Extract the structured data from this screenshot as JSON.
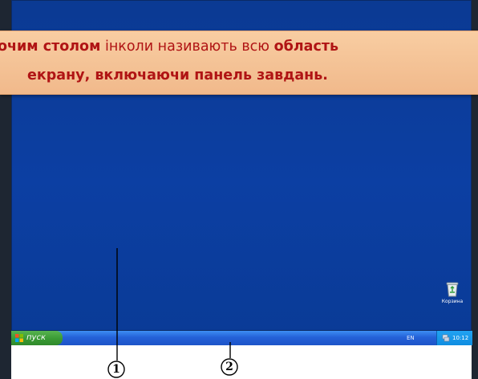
{
  "caption": {
    "line1_prefix": "очим столом",
    "line1_middle": " інколи називають всю ",
    "line1_suffix": "область",
    "line2": "екрану, включаючи панель завдань."
  },
  "taskbar": {
    "start_label": "пуск",
    "language": "EN",
    "clock": "10:12"
  },
  "desktop_icons": [
    {
      "label": "Корзина",
      "icon": "recycle-bin-icon"
    }
  ],
  "markers": [
    {
      "number": "1"
    },
    {
      "number": "2"
    }
  ],
  "colors": {
    "desktop": "#0c3fa3",
    "caption_bg": "#f4c296",
    "caption_text": "#b01414",
    "taskbar": "#2461d8",
    "start_button": "#3a9a34",
    "tray": "#0f8de1"
  }
}
